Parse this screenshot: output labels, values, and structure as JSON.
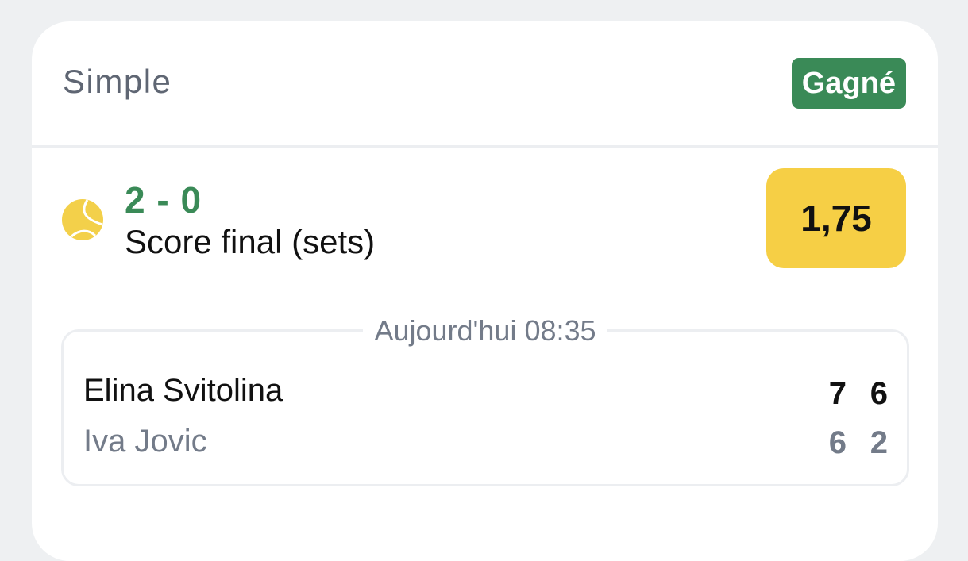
{
  "bet": {
    "type_label": "Simple",
    "status": "Gagné",
    "status_color": "#3a8a57",
    "sport_icon": "tennis-ball-icon",
    "selection": "2 - 0",
    "market": "Score final (sets)",
    "odds": "1,75",
    "odds_color": "#f6cf45"
  },
  "match": {
    "date": "Aujourd'hui 08:35",
    "players": [
      {
        "name": "Elina Svitolina",
        "sets": [
          "7",
          "6"
        ]
      },
      {
        "name": "Iva Jovic",
        "sets": [
          "6",
          "2"
        ]
      }
    ]
  }
}
